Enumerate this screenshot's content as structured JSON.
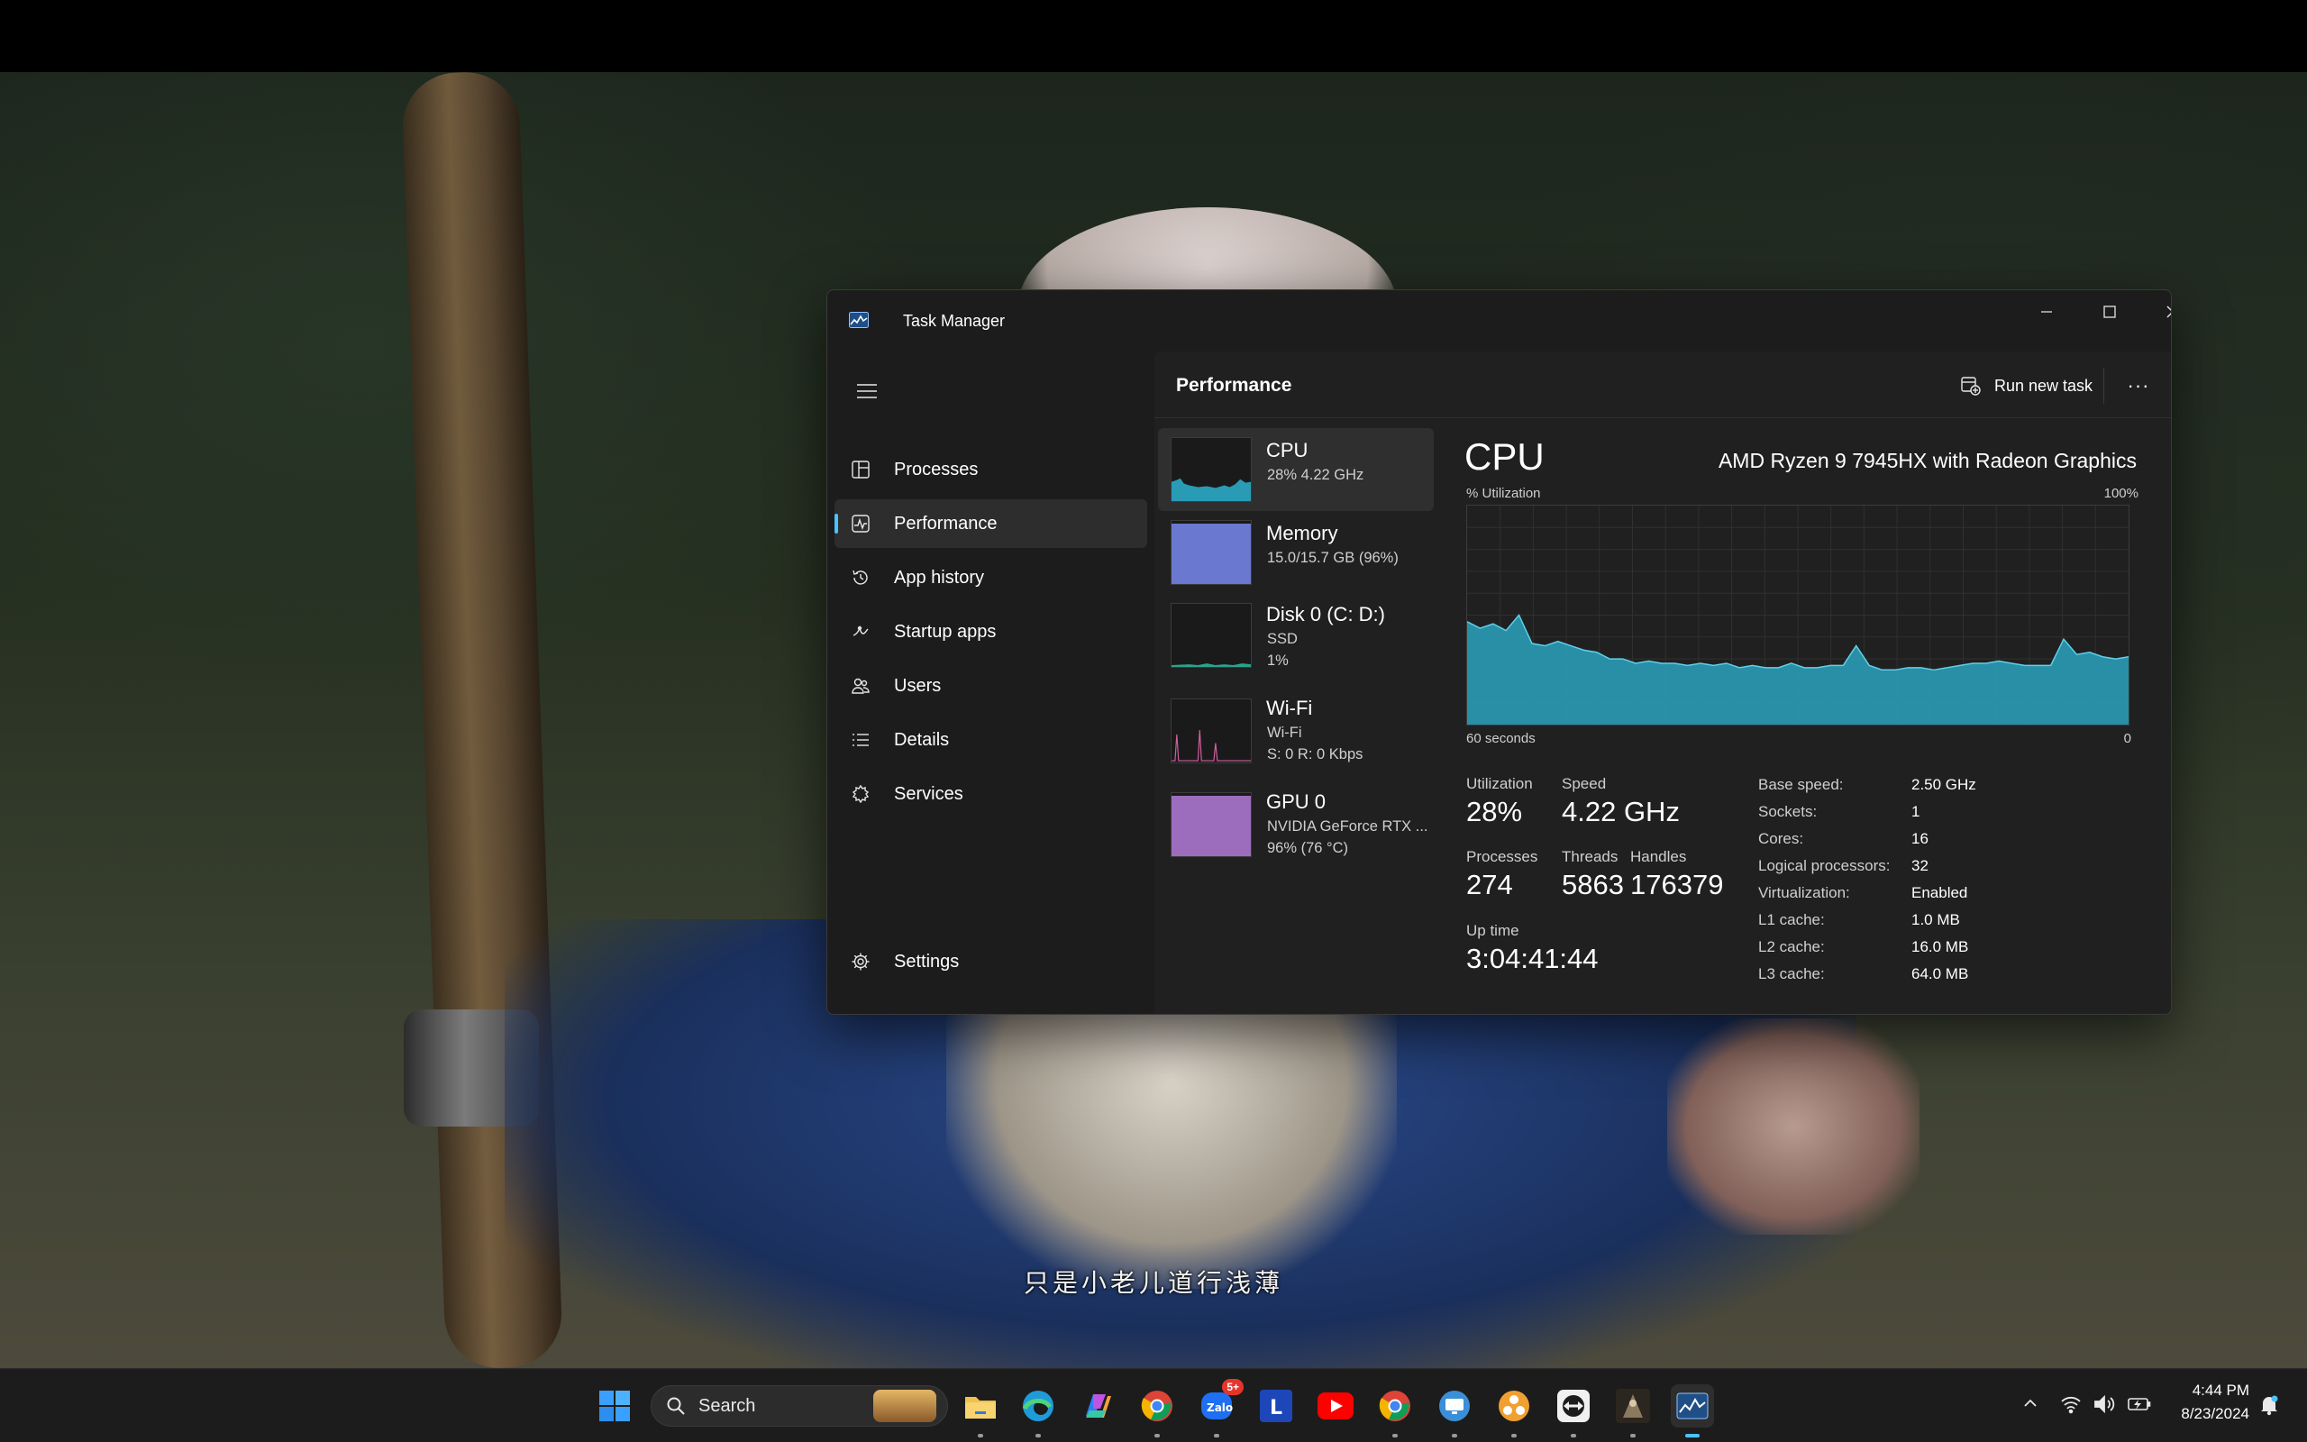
{
  "subtitle": "只是小老儿道行浅薄",
  "window": {
    "title": "Task Manager",
    "section_title": "Performance",
    "run_new_task_label": "Run new task",
    "more_label": "···"
  },
  "nav": {
    "items": [
      {
        "label": "Processes",
        "icon": "processes-icon"
      },
      {
        "label": "Performance",
        "icon": "performance-icon",
        "active": true
      },
      {
        "label": "App history",
        "icon": "history-icon"
      },
      {
        "label": "Startup apps",
        "icon": "startup-icon"
      },
      {
        "label": "Users",
        "icon": "users-icon"
      },
      {
        "label": "Details",
        "icon": "details-icon"
      },
      {
        "label": "Services",
        "icon": "services-icon"
      }
    ],
    "settings_label": "Settings"
  },
  "devices": [
    {
      "name": "CPU",
      "sub1": "28%  4.22 GHz",
      "sub2": "",
      "color": "#2a9bb5"
    },
    {
      "name": "Memory",
      "sub1": "15.0/15.7 GB (96%)",
      "sub2": "",
      "color": "#6a78cf",
      "fill": 0.96
    },
    {
      "name": "Disk 0 (C: D:)",
      "sub1": "SSD",
      "sub2": "1%",
      "color": "#2ba38a"
    },
    {
      "name": "Wi-Fi",
      "sub1": "Wi-Fi",
      "sub2": "S: 0  R: 0 Kbps",
      "color": "#d25fa0"
    },
    {
      "name": "GPU 0",
      "sub1": "NVIDIA GeForce RTX ...",
      "sub2": "96%  (76 °C)",
      "color": "#9d6dbd",
      "fill": 0.96
    }
  ],
  "detail": {
    "heading": "CPU",
    "model": "AMD Ryzen 9 7945HX with Radeon Graphics",
    "axis_top_left": "% Utilization",
    "axis_top_right": "100%",
    "axis_bottom_left": "60 seconds",
    "axis_bottom_right": "0",
    "stats": {
      "utilization_label": "Utilization",
      "utilization": "28%",
      "speed_label": "Speed",
      "speed": "4.22 GHz",
      "processes_label": "Processes",
      "processes": "274",
      "threads_label": "Threads",
      "threads": "5863",
      "handles_label": "Handles",
      "handles": "176379",
      "uptime_label": "Up time",
      "uptime": "3:04:41:44"
    },
    "specs": [
      {
        "k": "Base speed:",
        "v": "2.50 GHz"
      },
      {
        "k": "Sockets:",
        "v": "1"
      },
      {
        "k": "Cores:",
        "v": "16"
      },
      {
        "k": "Logical processors:",
        "v": "32"
      },
      {
        "k": "Virtualization:",
        "v": "Enabled"
      },
      {
        "k": "L1 cache:",
        "v": "1.0 MB"
      },
      {
        "k": "L2 cache:",
        "v": "16.0 MB"
      },
      {
        "k": "L3 cache:",
        "v": "64.0 MB"
      }
    ]
  },
  "chart_data": {
    "type": "area",
    "xlabel": "60 seconds",
    "ylabel": "% Utilization",
    "ylim": [
      0,
      100
    ],
    "x_range": [
      60,
      0
    ],
    "color": "#2a9bb5",
    "values": [
      47,
      44,
      46,
      43,
      50,
      37,
      36,
      38,
      36,
      34,
      33,
      30,
      30,
      28,
      29,
      28,
      28,
      27,
      28,
      27,
      28,
      26,
      27,
      26,
      26,
      28,
      26,
      26,
      27,
      27,
      36,
      27,
      25,
      25,
      26,
      26,
      25,
      26,
      27,
      28,
      28,
      29,
      28,
      27,
      27,
      27,
      39,
      32,
      33,
      31,
      30,
      31
    ]
  },
  "taskbar": {
    "search_label": "Search",
    "apps": [
      "windows-start-icon",
      "file-explorer-icon",
      "edge-icon",
      "copilot-icon",
      "chrome-icon",
      "zalo-icon",
      "l-app-icon",
      "youtube-icon",
      "chrome-profile-icon",
      "remote-desktop-icon",
      "cluster-app-icon",
      "teamviewer-icon",
      "game-icon",
      "task-manager-icon"
    ],
    "badge": "5+",
    "time": "4:44 PM",
    "date": "8/23/2024"
  }
}
